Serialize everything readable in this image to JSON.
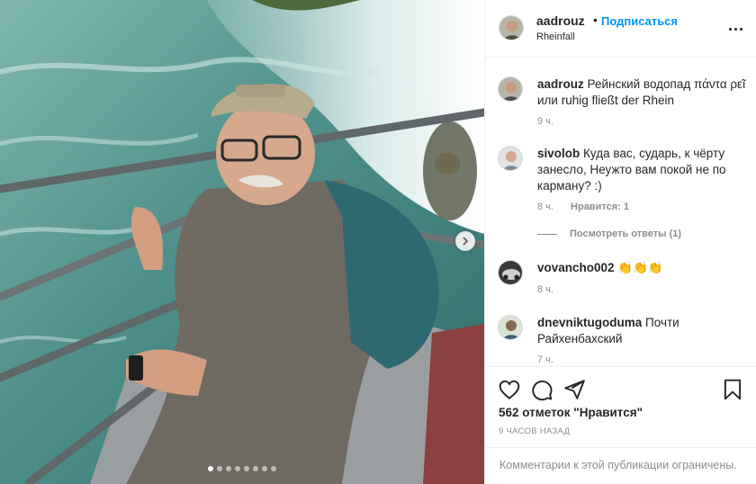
{
  "header": {
    "username": "aadrouz",
    "separator": "•",
    "follow_label": "Подписаться",
    "location": "Rheinfall"
  },
  "comments": [
    {
      "username": "aadrouz",
      "text": "Рейнский водопад πάντα ρεῖ или ruhig fließt der Rhein",
      "time": "9 ч."
    },
    {
      "username": "sivolob",
      "text": "Куда вас, сударь, к чёрту занесло, Неужто вам покой не по карману? :)",
      "time": "8 ч.",
      "likes": "Нравится: 1",
      "view_replies": "Посмотреть ответы (1)"
    },
    {
      "username": "vovancho002",
      "text": "👏👏👏",
      "time": "8 ч."
    },
    {
      "username": "dnevniktugoduma",
      "text": "Почти Райхенбахский",
      "time": "7 ч."
    }
  ],
  "actions": {
    "like_icon": "heart-icon",
    "comment_icon": "comment-bubble-icon",
    "share_icon": "paper-plane-icon",
    "save_icon": "bookmark-icon",
    "likes_count": "562 отметок \"Нравится\"",
    "time_ago": "9 ЧАСОВ НАЗАД"
  },
  "restricted_text": "Комментарии к этой публикации ограничены.",
  "carousel": {
    "total": 8,
    "current": 1
  }
}
